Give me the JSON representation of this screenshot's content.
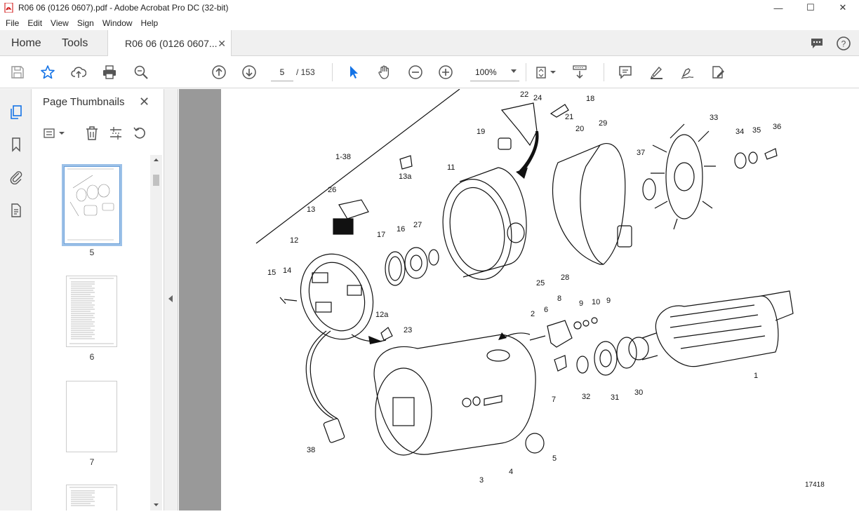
{
  "window": {
    "title": "R06 06 (0126 0607).pdf - Adobe Acrobat Pro DC (32-bit)"
  },
  "menu": [
    "File",
    "Edit",
    "View",
    "Sign",
    "Window",
    "Help"
  ],
  "tabs": {
    "home": "Home",
    "tools": "Tools",
    "document": "R06 06 (0126 0607..."
  },
  "toolbar": {
    "page_current": "5",
    "page_total": "/ 153",
    "zoom": "100%"
  },
  "sidebar": {
    "title": "Page Thumbnails",
    "thumbnails": [
      {
        "label": "5"
      },
      {
        "label": "6"
      },
      {
        "label": "7"
      }
    ]
  },
  "figure": {
    "figure_number": "17418",
    "callouts": [
      "1-38",
      "22",
      "24",
      "18",
      "19",
      "21",
      "20",
      "29",
      "33",
      "34",
      "35",
      "36",
      "13a",
      "11",
      "37",
      "26",
      "13",
      "17",
      "16",
      "27",
      "12",
      "15",
      "14",
      "25",
      "28",
      "2",
      "6",
      "8",
      "9",
      "10",
      "9",
      "12a",
      "23",
      "7",
      "32",
      "31",
      "30",
      "1",
      "38",
      "3",
      "4",
      "5"
    ]
  },
  "colors": {
    "accent": "#1473e6",
    "tab_bg": "#f0f0f0",
    "doc_bg": "#999999"
  }
}
